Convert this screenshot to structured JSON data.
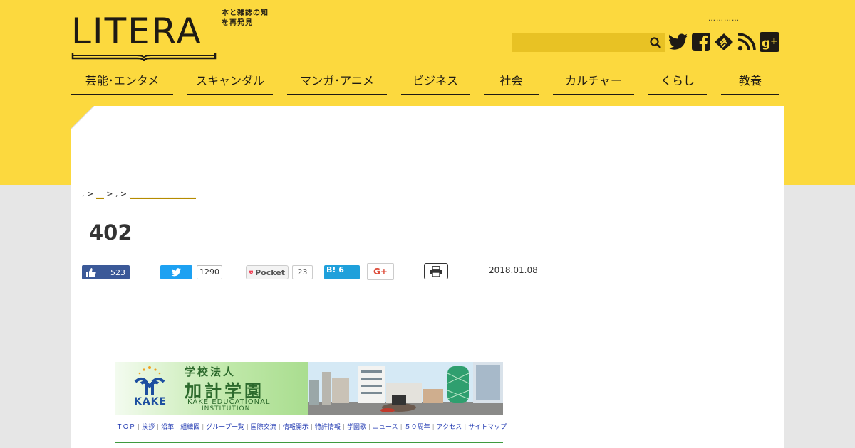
{
  "logo": {
    "word": "LITERA",
    "tagline": "本と雑誌の知を再発見"
  },
  "header": {
    "dots": "…………",
    "search_placeholder": ""
  },
  "social": [
    "twitter-icon",
    "facebook-icon",
    "feedly-icon",
    "rss-icon",
    "google-plus-icon"
  ],
  "nav": [
    {
      "label": "芸能･エンタメ"
    },
    {
      "label": "スキャンダル"
    },
    {
      "label": "マンガ･アニメ"
    },
    {
      "label": "ビジネス"
    },
    {
      "label": "社会"
    },
    {
      "label": "カルチャー"
    },
    {
      "label": "くらし"
    },
    {
      "label": "教養"
    }
  ],
  "breadcrumb": {
    "sep1": ", > ",
    "link1": "__",
    "sep2": " > , > ",
    "link2": "_________________"
  },
  "article": {
    "title": "402",
    "date": "2018.01.08"
  },
  "share": {
    "fb_count": "523",
    "tw_count": "1290",
    "pocket_label": "Pocket",
    "pocket_count": "23",
    "hatena_label": "B!",
    "hatena_count": "6",
    "gplus_label": "G+"
  },
  "banner": {
    "brand": "KAKE",
    "title_line1": "学校法人",
    "title_line2": "加計学園",
    "en_line1": "KAKE EDUCATIONAL",
    "en_line2": "INSTITUTION",
    "links": [
      "ＴＯＰ",
      "挨拶",
      "沿革",
      "組織図",
      "グループ一覧",
      "国際交流",
      "情報開示",
      "特許情報",
      "学園歌",
      "ニュース",
      "５０周年",
      "アクセス",
      "サイトマップ"
    ]
  },
  "colors": {
    "header_bg": "#fcd93e",
    "ink": "#1e1a14",
    "facebook": "#3b5998",
    "twitter": "#1da1f2",
    "hatena": "#1fa0db"
  }
}
